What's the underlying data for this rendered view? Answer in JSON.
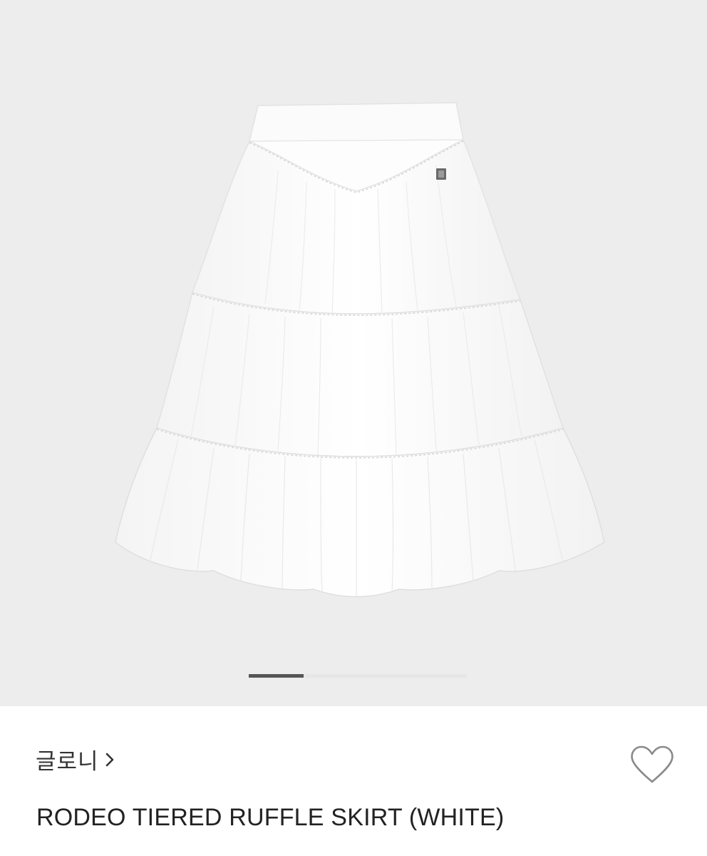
{
  "gallery": {
    "image_alt": "white tiered ruffle skirt",
    "current_slide": 1,
    "slide_progress": 0.25,
    "background_color": "#ededed",
    "indicator_active_color": "#555555"
  },
  "product": {
    "brand": "글로니",
    "brand_chevron_icon": "chevron-right-icon",
    "title": "RODEO TIERED RUFFLE SKIRT (WHITE)",
    "like_icon": "heart-outline-icon"
  }
}
